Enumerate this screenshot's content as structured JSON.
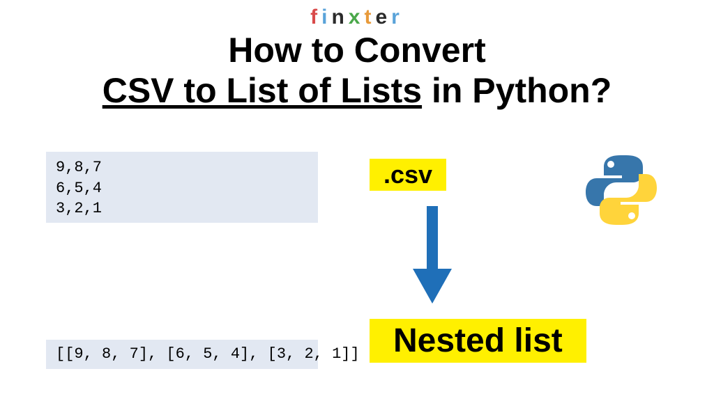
{
  "logo": {
    "f": "f",
    "i1": "i",
    "n": "n",
    "x": "x",
    "t": "t",
    "e": "e",
    "r": "r"
  },
  "title": {
    "line1": "How to Convert",
    "underlined": "CSV to List of Lists",
    "tail": " in Python?"
  },
  "csv_content": "9,8,7\n6,5,4\n3,2,1",
  "list_content": "[[9, 8, 7], [6, 5, 4], [3, 2, 1]]",
  "labels": {
    "csv": ".csv",
    "nested": "Nested list"
  }
}
